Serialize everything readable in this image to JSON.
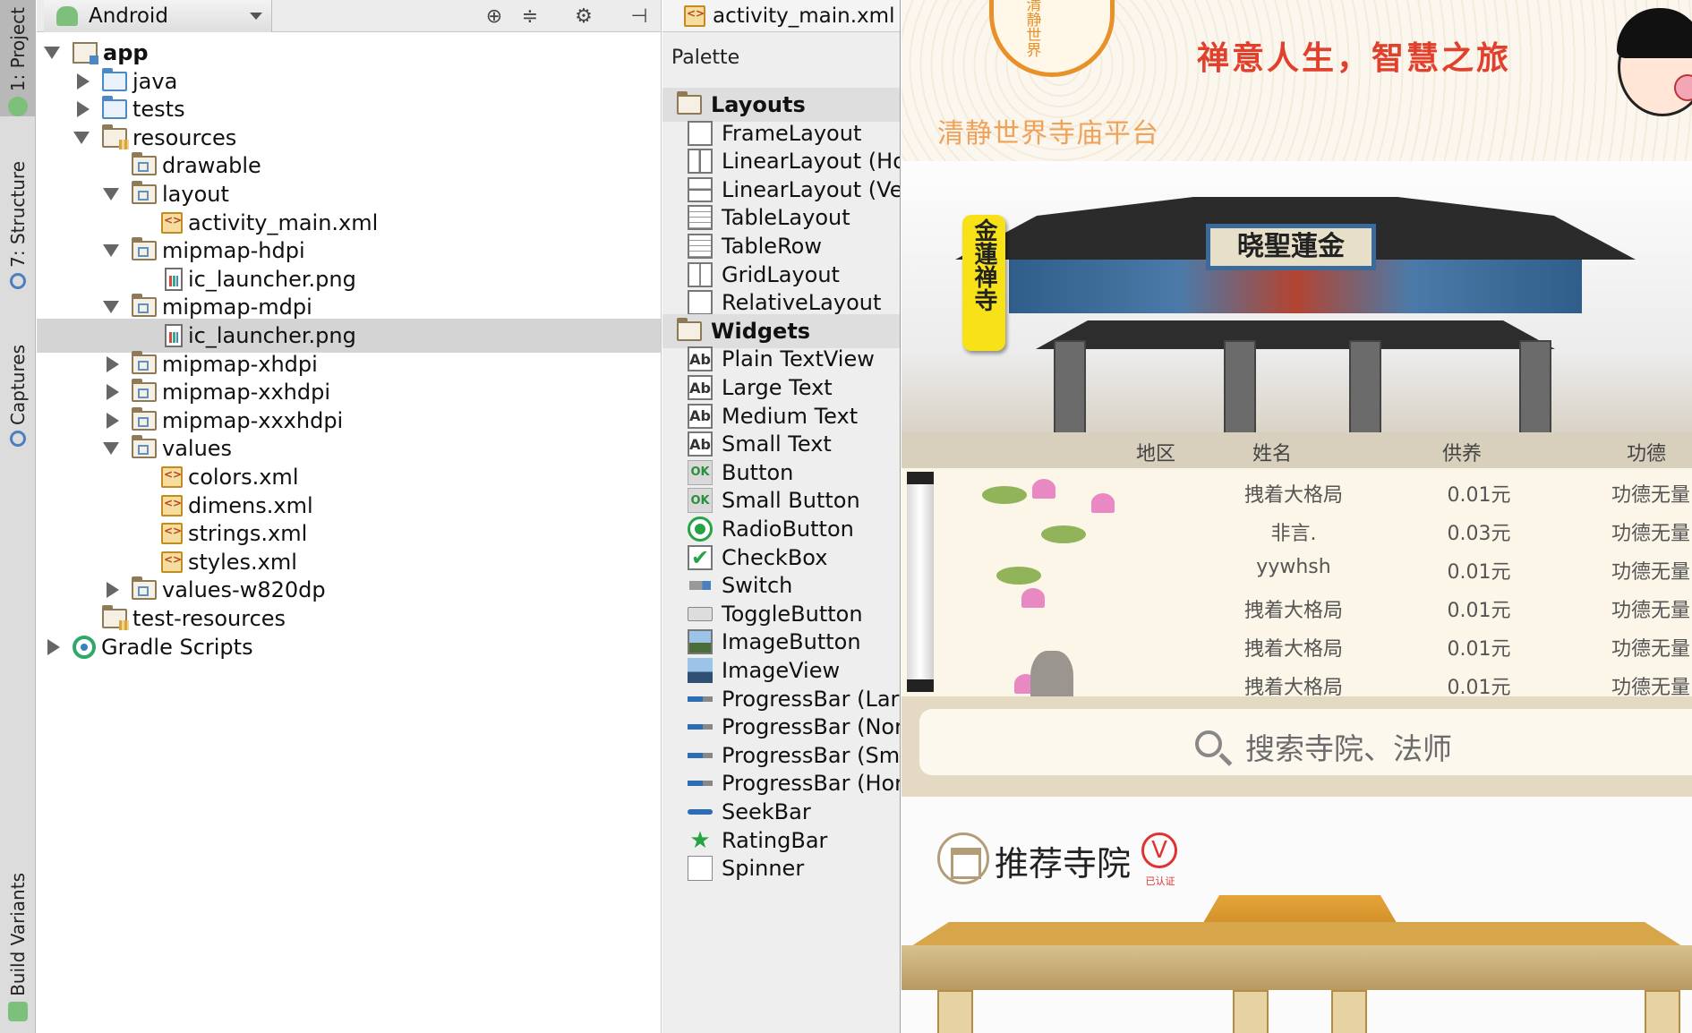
{
  "tool_strip": {
    "project_tab": "1: Project",
    "structure_tab": "7: Structure",
    "captures_tab": "Captures",
    "build_variants_tab": "Build Variants"
  },
  "project_panel": {
    "view_mode": "Android",
    "tree": [
      {
        "label": "app",
        "depth": 0,
        "arrow": "down",
        "icon": "module-folder-icon",
        "bold": true
      },
      {
        "label": "java",
        "depth": 1,
        "arrow": "right",
        "icon": "source-folder-icon"
      },
      {
        "label": "tests",
        "depth": 1,
        "arrow": "right",
        "icon": "test-folder-icon"
      },
      {
        "label": "resources",
        "depth": 1,
        "arrow": "down",
        "icon": "resources-folder-icon"
      },
      {
        "label": "drawable",
        "depth": 2,
        "arrow": "none",
        "icon": "folder-icon"
      },
      {
        "label": "layout",
        "depth": 2,
        "arrow": "down",
        "icon": "folder-icon"
      },
      {
        "label": "activity_main.xml",
        "depth": 3,
        "arrow": "none",
        "icon": "xml-file-icon"
      },
      {
        "label": "mipmap-hdpi",
        "depth": 2,
        "arrow": "down",
        "icon": "folder-icon"
      },
      {
        "label": "ic_launcher.png",
        "depth": 3,
        "arrow": "none",
        "icon": "png-file-icon"
      },
      {
        "label": "mipmap-mdpi",
        "depth": 2,
        "arrow": "down",
        "icon": "folder-icon"
      },
      {
        "label": "ic_launcher.png",
        "depth": 3,
        "arrow": "none",
        "icon": "png-file-icon",
        "selected": true
      },
      {
        "label": "mipmap-xhdpi",
        "depth": 2,
        "arrow": "right",
        "icon": "folder-icon"
      },
      {
        "label": "mipmap-xxhdpi",
        "depth": 2,
        "arrow": "right",
        "icon": "folder-icon"
      },
      {
        "label": "mipmap-xxxhdpi",
        "depth": 2,
        "arrow": "right",
        "icon": "folder-icon"
      },
      {
        "label": "values",
        "depth": 2,
        "arrow": "down",
        "icon": "folder-icon"
      },
      {
        "label": "colors.xml",
        "depth": 3,
        "arrow": "none",
        "icon": "xml-file-icon"
      },
      {
        "label": "dimens.xml",
        "depth": 3,
        "arrow": "none",
        "icon": "xml-file-icon"
      },
      {
        "label": "strings.xml",
        "depth": 3,
        "arrow": "none",
        "icon": "xml-file-icon"
      },
      {
        "label": "styles.xml",
        "depth": 3,
        "arrow": "none",
        "icon": "xml-file-icon"
      },
      {
        "label": "values-w820dp",
        "depth": 2,
        "arrow": "right",
        "icon": "folder-icon"
      },
      {
        "label": "test-resources",
        "depth": 1,
        "arrow": "none",
        "icon": "resources-folder-icon"
      },
      {
        "label": "Gradle Scripts",
        "depth": 0,
        "arrow": "right",
        "icon": "gradle-icon"
      }
    ]
  },
  "editor": {
    "tab_label": "activity_main.xml",
    "palette_title": "Palette",
    "palette": [
      {
        "label": "Layouts",
        "group": true,
        "icon": "folder-icon"
      },
      {
        "label": "FrameLayout",
        "icon": "frame-layout-icon"
      },
      {
        "label": "LinearLayout (Horizontal)",
        "icon": "linear-layout-horizontal-icon"
      },
      {
        "label": "LinearLayout (Vertical)",
        "icon": "linear-layout-vertical-icon"
      },
      {
        "label": "TableLayout",
        "icon": "table-layout-icon"
      },
      {
        "label": "TableRow",
        "icon": "table-row-icon"
      },
      {
        "label": "GridLayout",
        "icon": "grid-layout-icon"
      },
      {
        "label": "RelativeLayout",
        "icon": "relative-layout-icon"
      },
      {
        "label": "Widgets",
        "group": true,
        "icon": "folder-icon"
      },
      {
        "label": "Plain TextView",
        "icon": "textview-icon"
      },
      {
        "label": "Large Text",
        "icon": "textview-icon"
      },
      {
        "label": "Medium Text",
        "icon": "textview-icon"
      },
      {
        "label": "Small Text",
        "icon": "textview-icon"
      },
      {
        "label": "Button",
        "icon": "button-icon"
      },
      {
        "label": "Small Button",
        "icon": "button-icon"
      },
      {
        "label": "RadioButton",
        "icon": "radio-button-icon"
      },
      {
        "label": "CheckBox",
        "icon": "checkbox-icon"
      },
      {
        "label": "Switch",
        "icon": "switch-icon"
      },
      {
        "label": "ToggleButton",
        "icon": "toggle-button-icon"
      },
      {
        "label": "ImageButton",
        "icon": "image-button-icon"
      },
      {
        "label": "ImageView",
        "icon": "image-view-icon"
      },
      {
        "label": "ProgressBar (Large)",
        "icon": "progress-bar-icon"
      },
      {
        "label": "ProgressBar (Normal)",
        "icon": "progress-bar-icon"
      },
      {
        "label": "ProgressBar (Small)",
        "icon": "progress-bar-icon"
      },
      {
        "label": "ProgressBar (Horizontal)",
        "icon": "progress-bar-icon"
      },
      {
        "label": "SeekBar",
        "icon": "seekbar-icon"
      },
      {
        "label": "RatingBar",
        "icon": "rating-bar-icon"
      },
      {
        "label": "Spinner",
        "icon": "spinner-icon"
      }
    ]
  },
  "preview": {
    "logo_chars": "清静世界",
    "slogan": "禅意人生，智慧之旅",
    "platform_name": "清静世界寺庙平台",
    "gate_plaque": "晓聖蓮金",
    "temple_tag": "金蓮禅寺",
    "donation": {
      "headers": [
        "地区",
        "姓名",
        "供养",
        "功德"
      ],
      "rows": [
        {
          "name": "拽着大格局",
          "amount": "0.01元",
          "merit": "功德无量"
        },
        {
          "name": "非言.",
          "amount": "0.03元",
          "merit": "功德无量"
        },
        {
          "name": "yywhsh",
          "amount": "0.01元",
          "merit": "功德无量"
        },
        {
          "name": "拽着大格局",
          "amount": "0.01元",
          "merit": "功德无量"
        },
        {
          "name": "拽着大格局",
          "amount": "0.01元",
          "merit": "功德无量"
        },
        {
          "name": "拽着大格局",
          "amount": "0.01元",
          "merit": "功德无量"
        }
      ]
    },
    "search_placeholder": "搜索寺院、法师",
    "recommend_title": "推荐寺院",
    "verified_badge": "V",
    "verified_label": "已认证"
  },
  "colors": {
    "slogan": "#e0402c",
    "platform_name": "#f0a259",
    "temple_tag_bg": "#f7e21a",
    "verified_red": "#e03232",
    "selection": "#d4d4d4"
  }
}
